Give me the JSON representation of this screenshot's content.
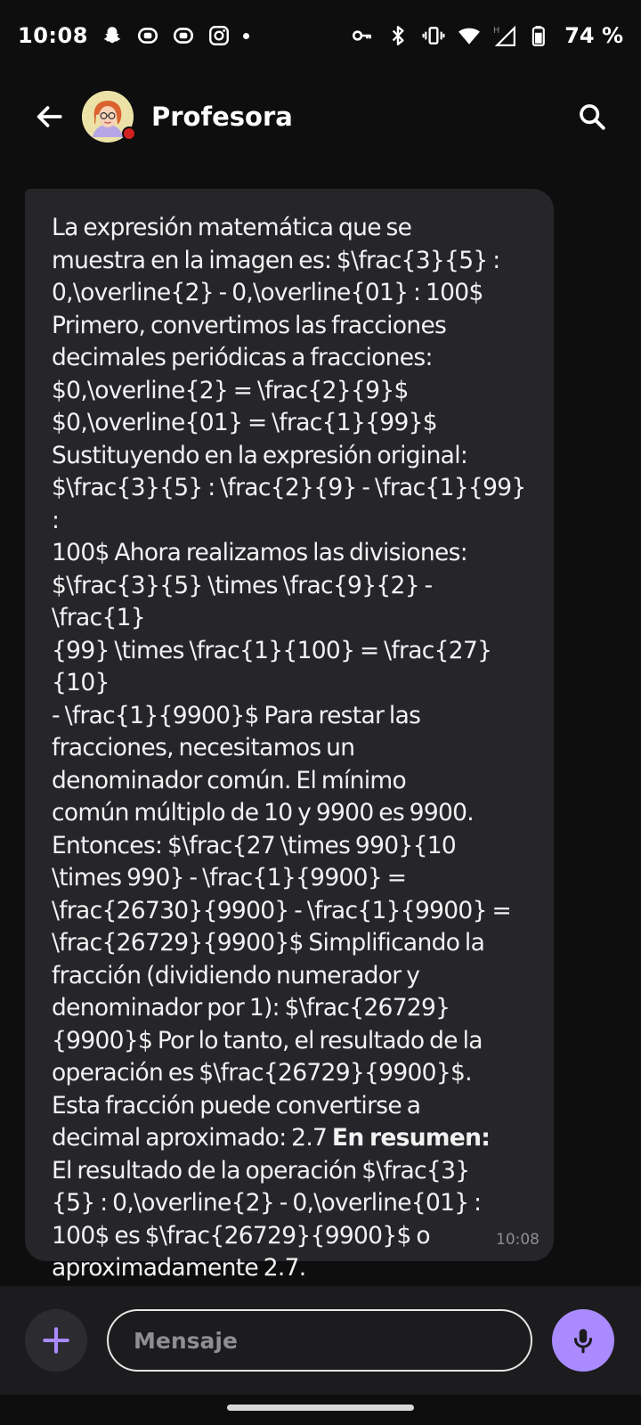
{
  "status_bar": {
    "time": "10:08",
    "battery": "74 %",
    "icons": [
      "snapchat-icon",
      "app-notification-icon",
      "app-notification-icon",
      "instagram-icon",
      "more-notifications-dot",
      "vpn-key-icon",
      "bluetooth-icon",
      "vibrate-icon",
      "wifi-icon",
      "signal-h-icon",
      "battery-icon"
    ]
  },
  "header": {
    "contact_name": "Profesora",
    "back_icon": "arrow-left-icon",
    "search_icon": "search-icon"
  },
  "message": {
    "text_before_bold": "La expresión matemática que se\nmuestra en la imagen es: $\\frac{3}{5} :\n0,\\overline{2} - 0,\\overline{01} : 100$\nPrimero, convertimos las fracciones\ndecimales periódicas a fracciones:\n$0,\\overline{2} = \\frac{2}{9}$\n$0,\\overline{01} = \\frac{1}{99}$\nSustituyendo en la expresión original:\n$\\frac{3}{5} : \\frac{2}{9} - \\frac{1}{99} :\n100$ Ahora realizamos las divisiones:\n$\\frac{3}{5} \\times \\frac{9}{2} - \\frac{1}\n{99} \\times \\frac{1}{100} = \\frac{27}{10}\n- \\frac{1}{9900}$ Para restar las\nfracciones, necesitamos un\ndenominador común. El mínimo\ncomún múltiplo de 10 y 9900 es 9900.\nEntonces: $\\frac{27 \\times 990}{10\n\\times 990} - \\frac{1}{9900} =\n\\frac{26730}{9900} - \\frac{1}{9900} =\n\\frac{26729}{9900}$ Simplificando la\nfracción (dividiendo numerador y\ndenominador por 1): $\\frac{26729}\n{9900}$ Por lo tanto, el resultado de la\noperación es $\\frac{26729}{9900}$.\nEsta fracción puede convertirse a\ndecimal aproximado: 2.7 ",
    "bold_text": "En resumen:",
    "text_after_bold": "\nEl resultado de la operación $\\frac{3}\n{5} : 0,\\overline{2} - 0,\\overline{01} :\n100$ es $\\frac{26729}{9900}$ o\naproximadamente 2.7.",
    "time": "10:08"
  },
  "input_bar": {
    "placeholder": "Mensaje",
    "add_icon": "plus-icon",
    "mic_icon": "microphone-icon"
  },
  "colors": {
    "background": "#0e0e0e",
    "bubble": "#26262a",
    "input_bar": "#1c1c1e",
    "accent": "#a98bff",
    "presence": "#d32020"
  }
}
